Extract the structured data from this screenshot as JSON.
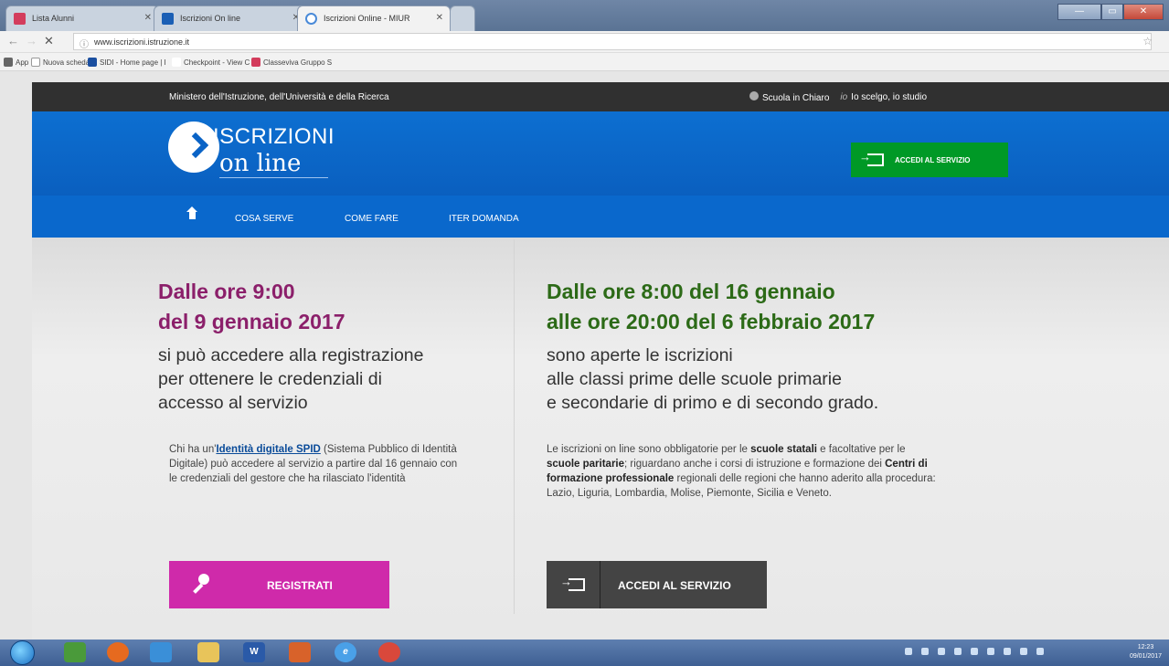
{
  "browser": {
    "tabs": [
      {
        "label": "Lista Alunni",
        "color": "#d33c5c"
      },
      {
        "label": "Iscrizioni On line",
        "color": "#1b5fb5"
      },
      {
        "label": "Iscrizioni Online - MIUR",
        "color": "#ffffff"
      }
    ],
    "url": "www.iscrizioni.istruzione.it",
    "bookmarks": [
      {
        "label": "App",
        "color": "#666"
      },
      {
        "label": "Nuova scheda",
        "color": "#999"
      },
      {
        "label": "SIDI - Home page | I",
        "color": "#1b4fa0"
      },
      {
        "label": "Checkpoint - View C",
        "color": "#777"
      },
      {
        "label": "Classeviva Gruppo S",
        "color": "#d33c5c"
      }
    ]
  },
  "site": {
    "ministry": "Ministero dell'Istruzione, dell'Università e della Ricerca",
    "link_scuola": "Scuola in Chiaro",
    "link_scelgo_logo": "io",
    "link_scelgo": "Io scelgo, io studio",
    "logo_title": "ISCRIZIONI",
    "logo_sub": "on line",
    "accedi_top": "ACCEDI AL SERVIZIO",
    "nav": [
      "COSA SERVE",
      "COME FARE",
      "ITER DOMANDA"
    ],
    "left": {
      "heading_line1": "Dalle ore 9:00",
      "heading_line2": "del 9 gennaio 2017",
      "text_line1": "si può accedere alla registrazione",
      "text_line2": "per ottenere le credenziali di",
      "text_line3": "accesso al servizio",
      "small_pre": "Chi ha un'",
      "small_link": "Identità digitale SPID",
      "small_post": " (Sistema Pubblico di Identità Digitale) può accedere al servizio a partire dal 16 gennaio con le credenziali del gestore che ha rilasciato l'identità",
      "button": "REGISTRATI"
    },
    "right": {
      "heading_line1": "Dalle ore 8:00 del 16 gennaio",
      "heading_line2": "alle ore 20:00 del 6 febbraio 2017",
      "text_line1": "sono aperte le iscrizioni",
      "text_line2": "alle classi prime delle scuole primarie",
      "text_line3": "e secondarie di primo e di secondo grado.",
      "small_1": "Le iscrizioni on line sono obbligatorie per le ",
      "small_b1": "scuole statali",
      "small_2": " e facoltative per le ",
      "small_b2": "scuole paritarie",
      "small_3": "; riguardano anche i corsi di istruzione e formazione dei ",
      "small_b3": "Centri di formazione professionale",
      "small_4": " regionali delle regioni che hanno aderito alla procedura: Lazio, Liguria, Lombardia, Molise, Piemonte, Sicilia e Veneto.",
      "button": "ACCEDI AL SERVIZIO"
    }
  },
  "taskbar": {
    "apps": [
      {
        "name": "explorer",
        "color": "#4a9a3a"
      },
      {
        "name": "firefox",
        "color": "#e66a1f"
      },
      {
        "name": "ie-window",
        "color": "#3a8fd8"
      },
      {
        "name": "folder",
        "color": "#e8c45a"
      },
      {
        "name": "word",
        "color": "#2a5aa8",
        "label": "W"
      },
      {
        "name": "powerpoint",
        "color": "#d8622a"
      },
      {
        "name": "internet-explorer",
        "color": "#4aa0e8",
        "label": "e"
      },
      {
        "name": "chrome",
        "color": "#d9483b"
      }
    ],
    "time": "12:23",
    "date": "09/01/2017"
  }
}
